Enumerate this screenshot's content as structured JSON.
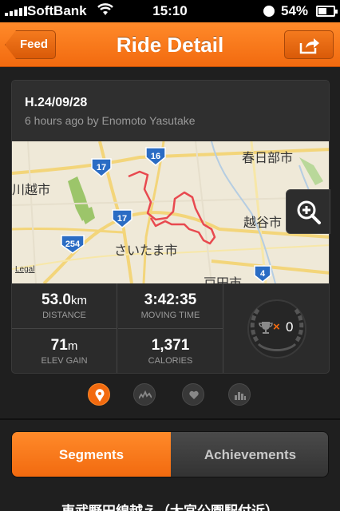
{
  "status_bar": {
    "carrier": "SoftBank",
    "time": "15:10",
    "battery_percent": "54%",
    "battery_level": 0.54
  },
  "nav": {
    "back_label": "Feed",
    "title": "Ride Detail",
    "share_icon": "share-icon"
  },
  "ride": {
    "title": "H.24/09/28",
    "subtitle": "6 hours ago by Enomoto Yasutake"
  },
  "map": {
    "labels": {
      "kasukabe": "春日部市",
      "kawagoe": "川越市",
      "koshigaya": "越谷市",
      "saitama": "さいたま市",
      "toda": "戸田市"
    },
    "route_shields": [
      "17",
      "16",
      "17",
      "254",
      "4"
    ],
    "legal": "Legal",
    "route_color": "#e8494f"
  },
  "stats": [
    {
      "value": "53.0",
      "unit": "km",
      "label": "DISTANCE"
    },
    {
      "value": "3:42:35",
      "unit": "",
      "label": "MOVING TIME"
    },
    {
      "value": "71",
      "unit": "m",
      "label": "ELEV GAIN"
    },
    {
      "value": "1,371",
      "unit": "",
      "label": "CALORIES"
    }
  ],
  "trophy": {
    "multiplier": "×",
    "count": "0"
  },
  "page_dots": [
    "location-icon",
    "graph-icon",
    "heart-icon",
    "bar-chart-icon"
  ],
  "tabs": {
    "segments": "Segments",
    "achievements": "Achievements"
  },
  "segment_preview": "東武野田線越え（大宮公園駅付近）",
  "colors": {
    "accent": "#f26a0f",
    "background": "#1f1f1f"
  }
}
